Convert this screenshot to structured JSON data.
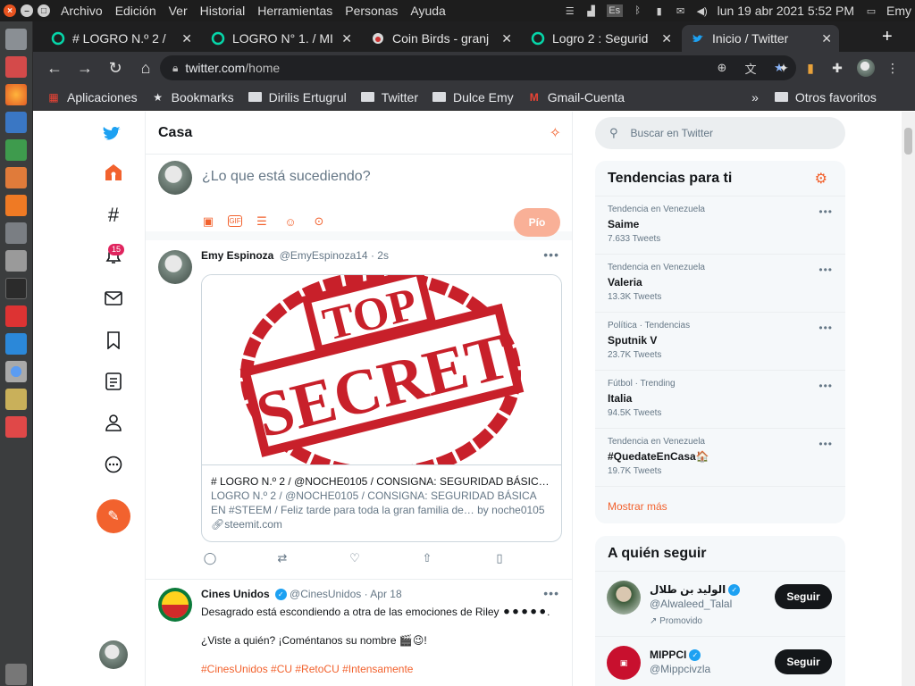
{
  "system": {
    "menus": [
      "Archivo",
      "Edición",
      "Ver",
      "Historial",
      "Herramientas",
      "Personas",
      "Ayuda"
    ],
    "tray_text": "Es",
    "clock": "lun 19 abr 2021  5:52 PM",
    "user": "Emy"
  },
  "tabs": [
    {
      "title": "# LOGRO N.º 2 /"
    },
    {
      "title": "LOGRO N° 1. / MI"
    },
    {
      "title": "Coin Birds - granj"
    },
    {
      "title": "Logro 2 : Segurid"
    },
    {
      "title": "Inicio / Twitter"
    }
  ],
  "toolbar": {
    "url_host": "twitter.com",
    "url_path": "/home"
  },
  "bookmarks": {
    "apps": "Aplicaciones",
    "items": [
      "Bookmarks",
      "Dirilis Ertugrul",
      "Twitter",
      "Dulce Emy",
      "Gmail-Cuenta"
    ],
    "overflow": "»",
    "other": "Otros favoritos"
  },
  "nav": {
    "badge": "15"
  },
  "main": {
    "title": "Casa",
    "composer_placeholder": "¿Lo que está sucediendo?",
    "tweet_button": "Pío"
  },
  "tweet1": {
    "name": "Emy Espinoza",
    "handle": "@EmyEspinoza14",
    "time": "· 2s",
    "card_image_text_1": "TOP",
    "card_image_text_2": "SECRET",
    "card_title": "# LOGRO N.º 2 / @NOCHE0105 / CONSIGNA: SEGURIDAD BÁSIC…",
    "card_desc": "LOGRO N.º 2 / @NOCHE0105 / CONSIGNA: SEGURIDAD BÁSICA EN #STEEM / Feliz tarde para toda la gran familia de… by noche0105",
    "card_link": "steemit.com"
  },
  "tweet2": {
    "name": "Cines Unidos",
    "handle": "@CinesUnidos",
    "time": "· Apr 18",
    "line1": "Desagrado está escondiendo a otra de las emociones de Riley ⚫⚫⚫⚫⚫.",
    "line2": "¿Viste a quién? ¡Coméntanos su nombre 🎬😉!",
    "hashtags": "#CinesUnidos #CU #RetoCU #Intensamente"
  },
  "search": {
    "placeholder": "Buscar en Twitter"
  },
  "trends": {
    "title": "Tendencias para ti",
    "items": [
      {
        "context": "Tendencia en Venezuela",
        "name": "Saime",
        "count": "7.633 Tweets"
      },
      {
        "context": "Tendencia en Venezuela",
        "name": "Valeria",
        "count": "13.3K Tweets"
      },
      {
        "context": "Política · Tendencias",
        "name": "Sputnik V",
        "count": "23.7K Tweets"
      },
      {
        "context": "Fútbol · Trending",
        "name": "Italia",
        "count": "94.5K Tweets"
      },
      {
        "context": "Tendencia en Venezuela",
        "name": "#QuedateEnCasa🏠",
        "count": "19.7K Tweets"
      }
    ],
    "show_more": "Mostrar más"
  },
  "who_to_follow": {
    "title": "A quién seguir",
    "items": [
      {
        "name": "الوليد بن طلال",
        "handle": "@Alwaleed_Talal",
        "promo": "Promovido",
        "button": "Seguir"
      },
      {
        "name": "MIPPCI",
        "handle": "@Mippcivzla",
        "button": "Seguir"
      }
    ]
  },
  "colors": {
    "accent": "#f2622e",
    "twitter_blue": "#1da1f2",
    "chrome_dark": "#35363a"
  }
}
